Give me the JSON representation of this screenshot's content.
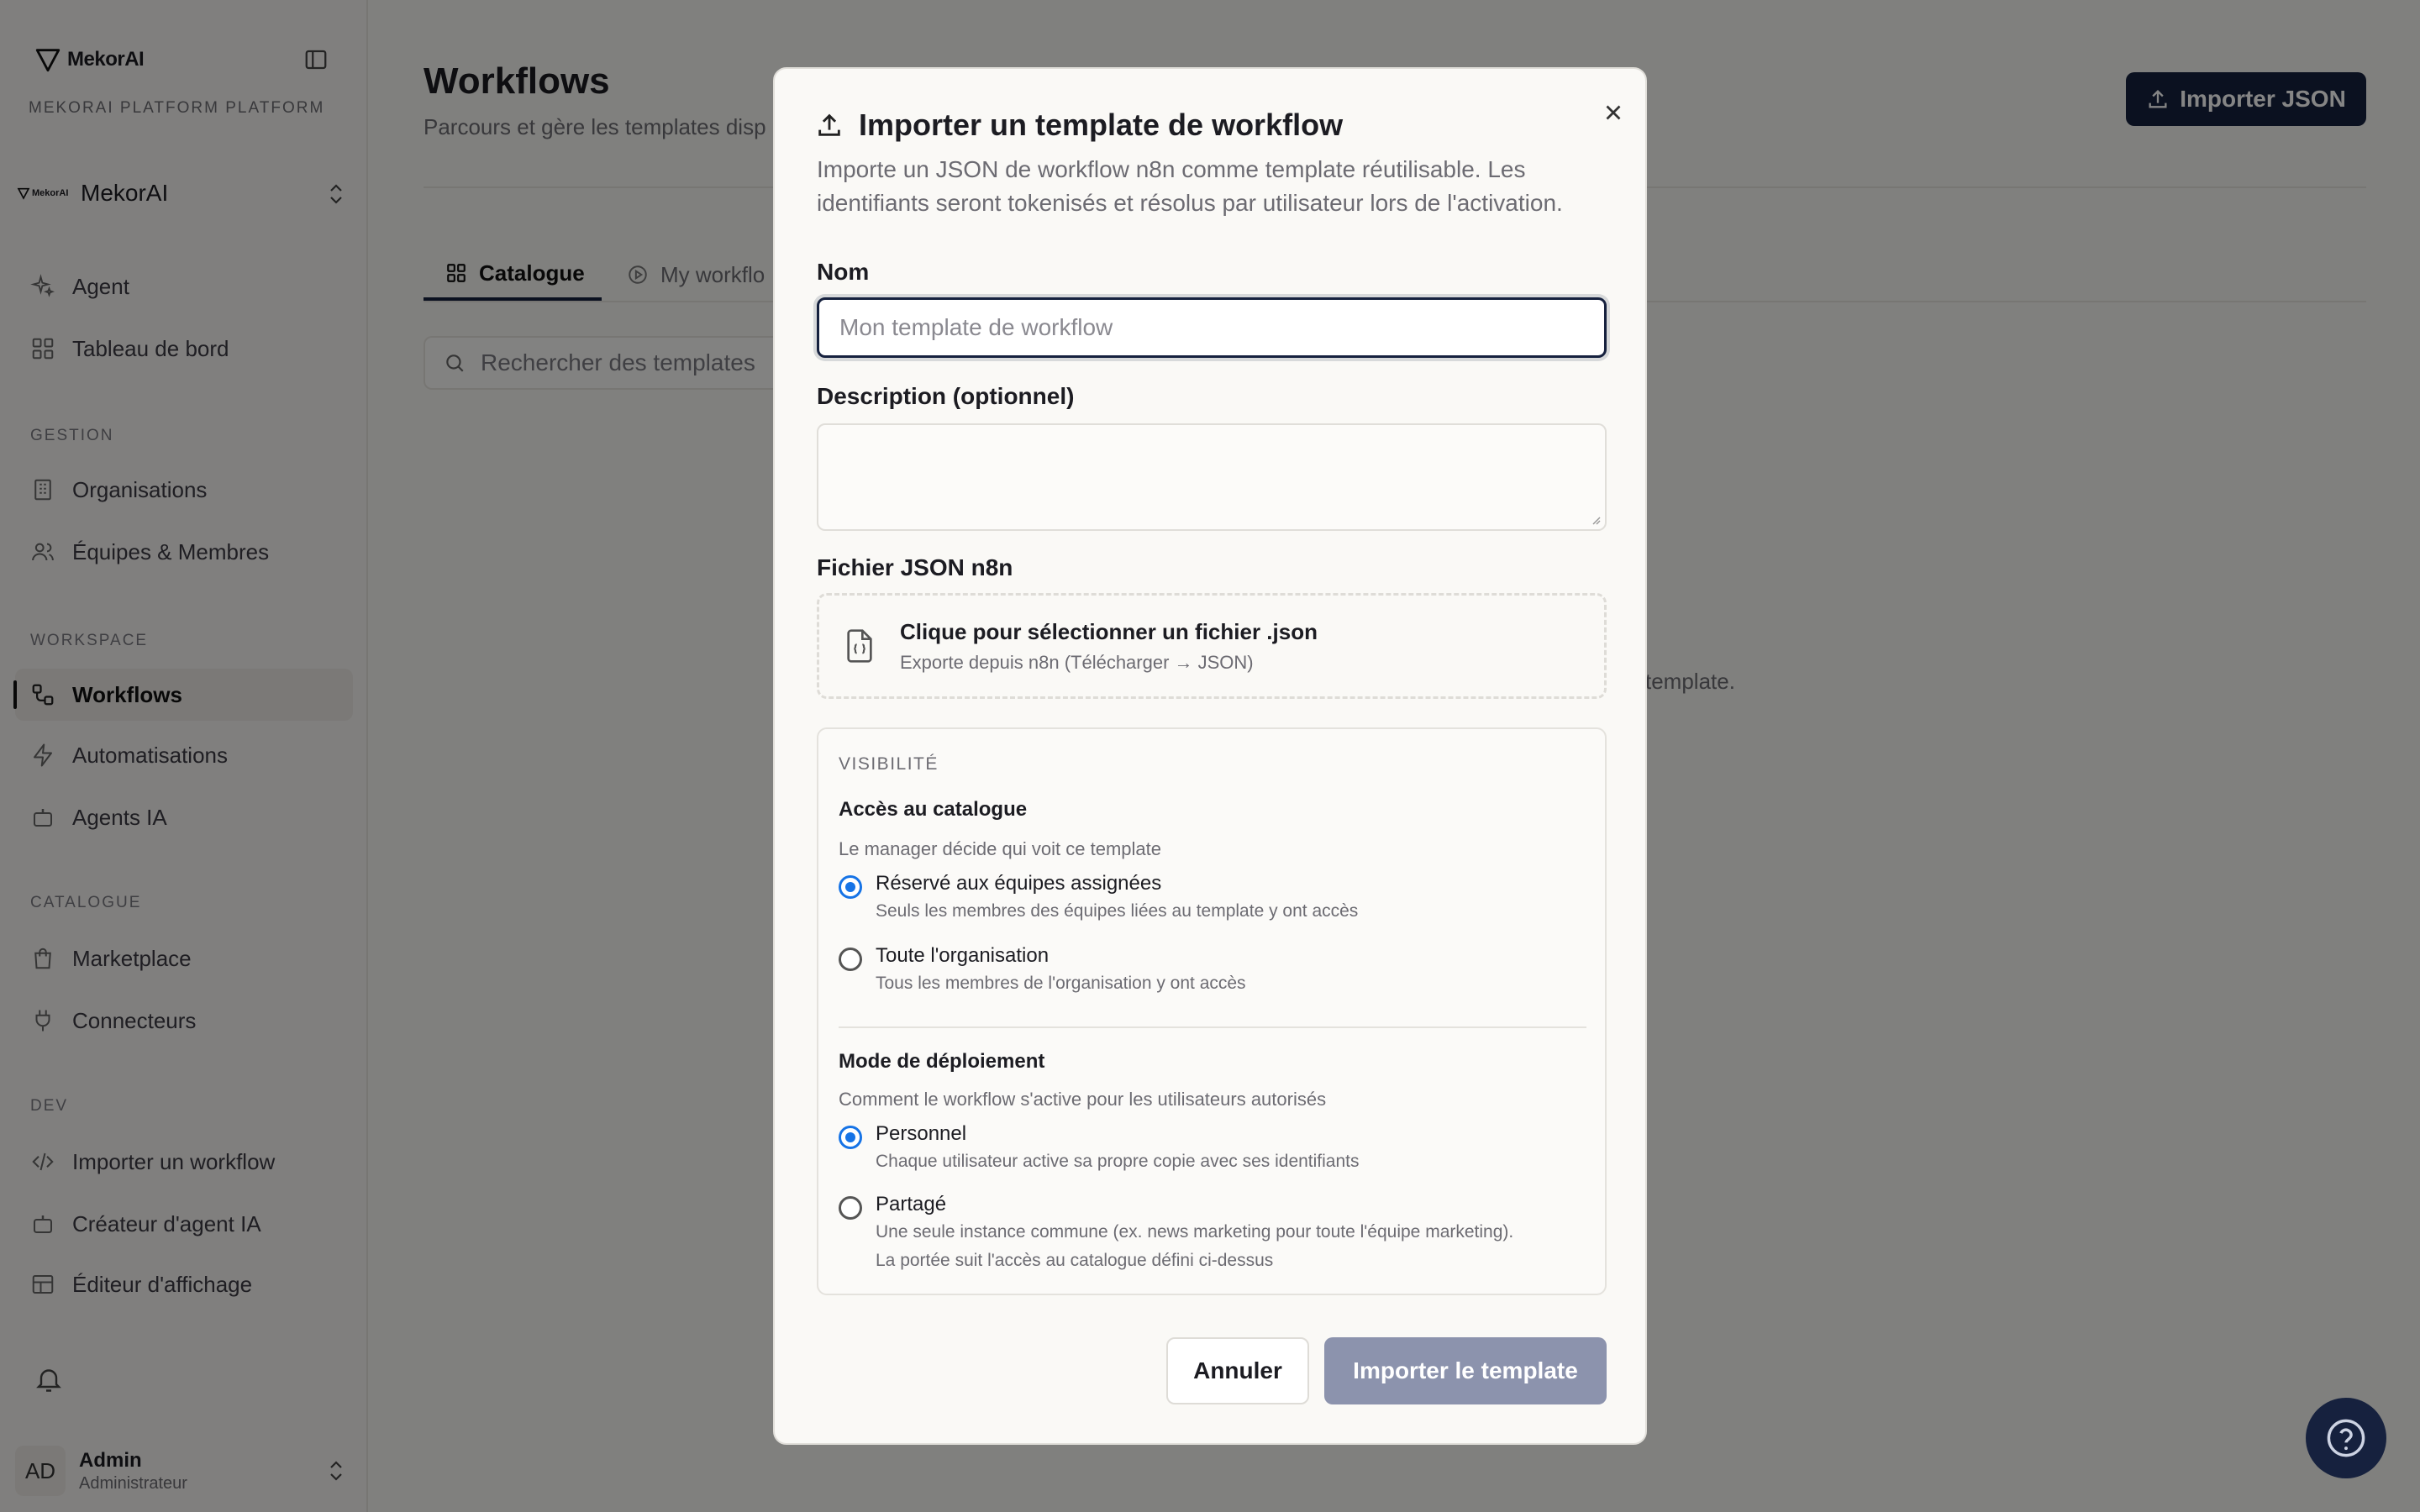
{
  "sidebar": {
    "brand": "MekorAI",
    "platform_label": "MEKORAI PLATFORM PLATFORM",
    "org": {
      "logo_text": "MekorAI",
      "name": "MekorAI"
    },
    "top_items": [
      {
        "label": "Agent",
        "icon": "sparkles-icon"
      },
      {
        "label": "Tableau de bord",
        "icon": "dashboard-icon"
      }
    ],
    "sections": [
      {
        "label": "GESTION",
        "items": [
          {
            "label": "Organisations",
            "icon": "building-icon"
          },
          {
            "label": "Équipes & Membres",
            "icon": "users-icon"
          }
        ]
      },
      {
        "label": "WORKSPACE",
        "items": [
          {
            "label": "Workflows",
            "icon": "workflow-icon",
            "active": true
          },
          {
            "label": "Automatisations",
            "icon": "zap-icon"
          },
          {
            "label": "Agents IA",
            "icon": "bot-icon"
          }
        ]
      },
      {
        "label": "CATALOGUE",
        "items": [
          {
            "label": "Marketplace",
            "icon": "shopping-bag-icon"
          },
          {
            "label": "Connecteurs",
            "icon": "plug-icon"
          }
        ]
      },
      {
        "label": "DEV",
        "items": [
          {
            "label": "Importer un workflow",
            "icon": "code-icon"
          },
          {
            "label": "Créateur d'agent IA",
            "icon": "bot-icon"
          },
          {
            "label": "Éditeur d'affichage",
            "icon": "layout-icon"
          }
        ]
      }
    ],
    "user": {
      "initials": "AD",
      "name": "Admin",
      "role": "Administrateur"
    }
  },
  "main": {
    "title": "Workflows",
    "subtitle": "Parcours et gère les templates disp",
    "import_button": "Importer JSON",
    "tabs": [
      {
        "label": "Catalogue",
        "active": true
      },
      {
        "label": "My workflo"
      }
    ],
    "search_placeholder": "Rechercher des templates",
    "empty_hint": "template."
  },
  "modal": {
    "title": "Importer un template de workflow",
    "description": "Importe un JSON de workflow n8n comme template réutilisable. Les identifiants seront tokenisés et résolus par utilisateur lors de l'activation.",
    "name_label": "Nom",
    "name_placeholder": "Mon template de workflow",
    "name_value": "",
    "desc_label": "Description (optionnel)",
    "desc_value": "",
    "file_label": "Fichier JSON n8n",
    "dropzone_main": "Clique pour sélectionner un fichier .json",
    "dropzone_sub": "Exporte depuis n8n (Télécharger → JSON)",
    "visibility": {
      "label": "VISIBILITÉ",
      "access": {
        "title": "Accès au catalogue",
        "subtitle": "Le manager décide qui voit ce template",
        "options": [
          {
            "label": "Réservé aux équipes assignées",
            "desc": "Seuls les membres des équipes liées au template y ont accès",
            "checked": true
          },
          {
            "label": "Toute l'organisation",
            "desc": "Tous les membres de l'organisation y ont accès",
            "checked": false
          }
        ]
      },
      "deploy": {
        "title": "Mode de déploiement",
        "subtitle": "Comment le workflow s'active pour les utilisateurs autorisés",
        "options": [
          {
            "label": "Personnel",
            "desc": "Chaque utilisateur active sa propre copie avec ses identifiants",
            "checked": true
          },
          {
            "label": "Partagé",
            "desc": "Une seule instance commune (ex. news marketing pour toute l'équipe marketing).",
            "desc2": "La portée suit l'accès au catalogue défini ci-dessus",
            "checked": false
          }
        ]
      }
    },
    "cancel_label": "Annuler",
    "submit_label": "Importer le template"
  },
  "colors": {
    "primary": "#16213e",
    "radio": "#1673e6",
    "submit_disabled": "#8c93ad"
  }
}
